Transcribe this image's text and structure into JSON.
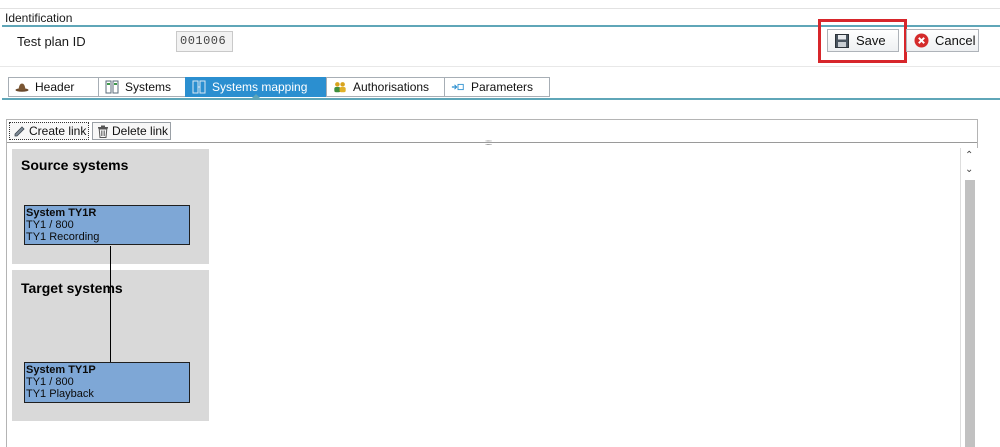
{
  "identification": {
    "title": "Identification",
    "test_plan_label": "Test plan ID",
    "test_plan_value": "001006"
  },
  "actions": {
    "save_label": "Save",
    "cancel_label": "Cancel"
  },
  "tabs": [
    {
      "label": "Header",
      "icon": "hat-icon"
    },
    {
      "label": "Systems",
      "icon": "systems-icon"
    },
    {
      "label": "Systems mapping",
      "icon": "mapping-icon",
      "active": true
    },
    {
      "label": "Authorisations",
      "icon": "users-icon"
    },
    {
      "label": "Parameters",
      "icon": "parameters-icon"
    }
  ],
  "toolbar": {
    "create_link": "Create link",
    "delete_link": "Delete link"
  },
  "mapping": {
    "source_title": "Source systems",
    "target_title": "Target systems",
    "source_node": {
      "name": "System TY1R",
      "client": "TY1 / 800",
      "desc": "TY1 Recording"
    },
    "target_node": {
      "name": "System TY1P",
      "client": "TY1 / 800",
      "desc": "TY1 Playback"
    }
  },
  "colors": {
    "accent": "#5fa6b8",
    "active_tab": "#2b8fd0",
    "highlight": "#d7262b",
    "node_fill": "#7ea7d6",
    "group_fill": "#d9d9d9"
  }
}
